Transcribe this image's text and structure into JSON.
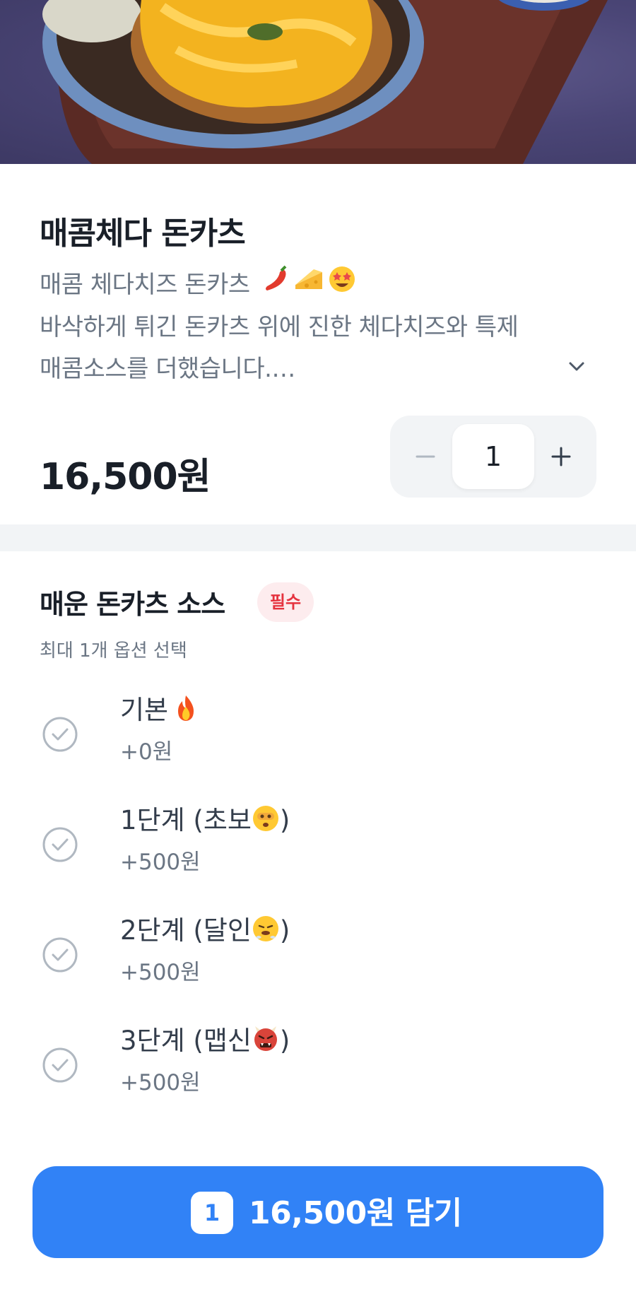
{
  "product": {
    "name": "매콤체다 돈카츠",
    "description_line1": "매콤 체다치즈 돈카츠",
    "description_line2": "바삭하게 튀긴 돈카츠 위에 진한 체다치즈와 특제",
    "description_line3": "매콤소스를 더했습니다.…",
    "description_emojis": [
      "chili-pepper-icon",
      "cheese-icon",
      "star-struck-face-icon"
    ],
    "price": "16,500원"
  },
  "quantity": {
    "value": "1"
  },
  "option_group": {
    "title": "매운 돈카츠 소스",
    "badge": "필수",
    "subtitle": "최대 1개 옵션 선택",
    "options": [
      {
        "label": "기본",
        "emoji": "fire-icon",
        "extra": "+0원"
      },
      {
        "label": "1단계 (초보",
        "emoji": "face-peeking-icon",
        "suffix": ")",
        "extra": "+500원"
      },
      {
        "label": "2단계 (달인",
        "emoji": "face-steam-nose-icon",
        "suffix": ")",
        "extra": "+500원"
      },
      {
        "label": "3단계 (맵신",
        "emoji": "ogre-icon",
        "suffix": ")",
        "extra": "+500원"
      }
    ]
  },
  "cart_button": {
    "count": "1",
    "label": "16,500원 담기"
  },
  "colors": {
    "accent": "#3182f6",
    "badge_bg": "#fdecee",
    "badge_text": "#e5323e",
    "text_secondary": "#6b7684"
  }
}
